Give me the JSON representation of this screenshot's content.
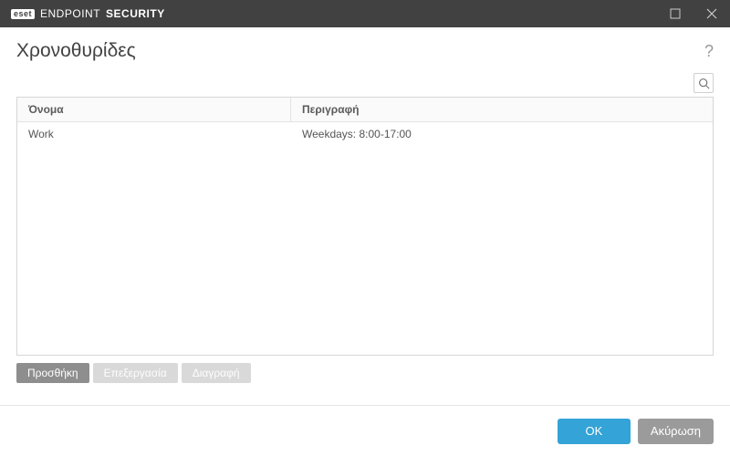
{
  "titlebar": {
    "brand_badge": "eset",
    "brand_thin": "ENDPOINT",
    "brand_bold": "SECURITY"
  },
  "header": {
    "title": "Χρονοθυρίδες",
    "help": "?"
  },
  "table": {
    "columns": {
      "name": "Όνομα",
      "description": "Περιγραφή"
    },
    "rows": [
      {
        "name": "Work",
        "description": "Weekdays: 8:00-17:00"
      }
    ]
  },
  "actions": {
    "add": "Προσθήκη",
    "edit": "Επεξεργασία",
    "delete": "Διαγραφή"
  },
  "footer": {
    "ok": "OK",
    "cancel": "Ακύρωση"
  }
}
